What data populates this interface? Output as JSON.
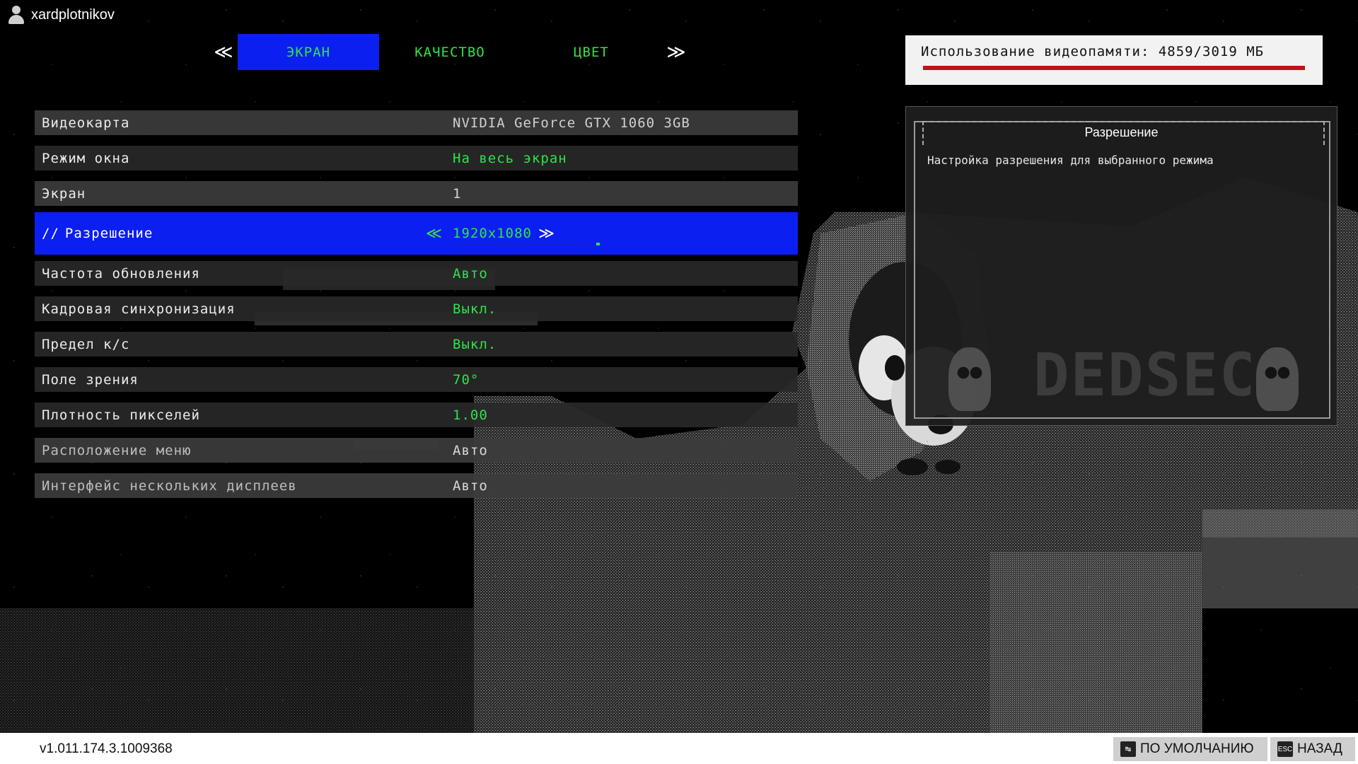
{
  "user": {
    "name": "xardplotnikov"
  },
  "tabs": {
    "prev_arrow": "≪",
    "next_arrow": "≫",
    "items": [
      {
        "label": "ЭКРАН",
        "active": true
      },
      {
        "label": "КАЧЕСТВО",
        "active": false
      },
      {
        "label": "ЦВЕТ",
        "active": false
      }
    ]
  },
  "vram": {
    "text": "Использование видеопамяти: 4859/3019 МБ",
    "bar_color": "#c1121a"
  },
  "settings": [
    {
      "label": "Видеокарта",
      "value": "NVIDIA GeForce GTX 1060 3GB"
    },
    {
      "label": "Режим окна",
      "value": "На весь экран"
    },
    {
      "label": "Экран",
      "value": "1"
    },
    {
      "label": "Разрешение",
      "value": "1920x1080",
      "prefix": "//"
    },
    {
      "label": "Частота обновления",
      "value": "Авто"
    },
    {
      "label": "Кадровая синхронизация",
      "value": "Выкл."
    },
    {
      "label": "Предел к/с",
      "value": "Выкл."
    },
    {
      "label": "Поле зрения",
      "value": "70°"
    },
    {
      "label": "Плотность пикселей",
      "value": "1.00"
    },
    {
      "label": "Расположение меню",
      "value": "Авто"
    },
    {
      "label": "Интерфейс нескольких дисплеев",
      "value": "Авто"
    }
  ],
  "selector": {
    "left_arrow": "≪",
    "right_arrow": "≫"
  },
  "info_panel": {
    "title": "Разрешение",
    "description": "Настройка разрешения для выбранного режима",
    "watermark": "DEDSEC"
  },
  "footer": {
    "version": "v1.011.174.3.1009368",
    "default_key": "↹",
    "default_label": "ПО УМОЛЧАНИЮ",
    "back_key": "ESC",
    "back_label": "НАЗАД"
  },
  "colors": {
    "accent_blue": "#0b1ff0",
    "value_green": "#2ee34a"
  }
}
